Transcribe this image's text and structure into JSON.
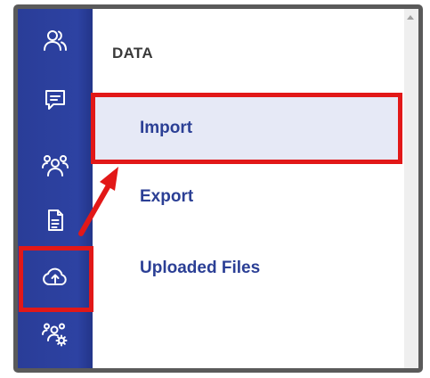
{
  "sidebar": {
    "icons": [
      {
        "name": "users-icon"
      },
      {
        "name": "chat-icon"
      },
      {
        "name": "team-icon"
      },
      {
        "name": "document-icon"
      },
      {
        "name": "cloud-upload-icon"
      },
      {
        "name": "team-settings-icon"
      }
    ]
  },
  "panel": {
    "section_title": "DATA",
    "items": [
      {
        "label": "Import",
        "active": true
      },
      {
        "label": "Export",
        "active": false
      },
      {
        "label": "Uploaded Files",
        "active": false
      }
    ]
  },
  "colors": {
    "rail": "#2d42a2",
    "accent_text": "#2b3f95",
    "active_bg": "#e6e9f6",
    "annotation": "#e21818"
  }
}
